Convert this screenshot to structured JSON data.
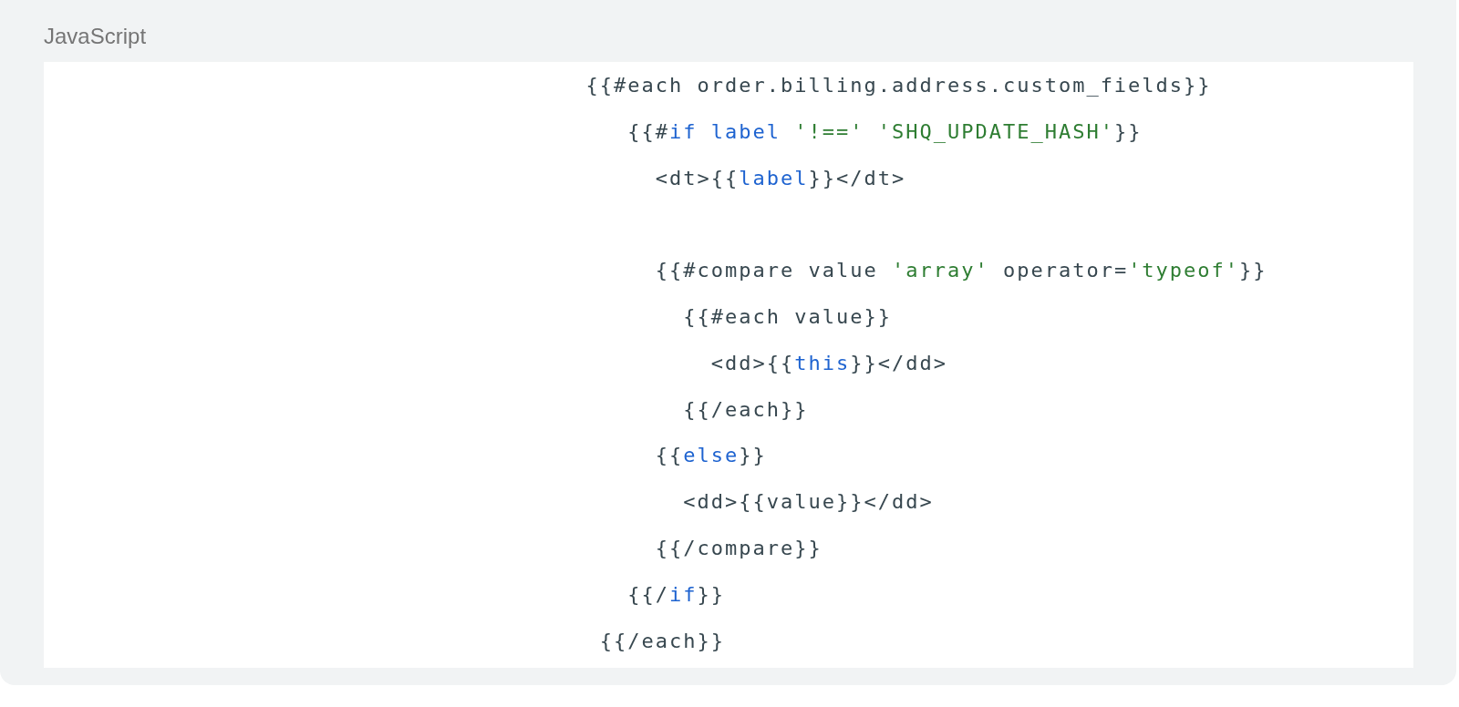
{
  "code_block": {
    "language": "JavaScript",
    "lines": [
      {
        "segments": [
          {
            "text": "                                       {{#each order.billing.address.custom_fields}}",
            "kind": "plain"
          }
        ]
      },
      {
        "segments": [
          {
            "text": "                                          {{#",
            "kind": "plain"
          },
          {
            "text": "if",
            "kind": "keyword"
          },
          {
            "text": " label",
            "kind": "keyword"
          },
          {
            "text": " '!=='",
            "kind": "string"
          },
          {
            "text": " 'SHQ_UPDATE_HASH'",
            "kind": "string"
          },
          {
            "text": "}}",
            "kind": "plain"
          }
        ]
      },
      {
        "segments": [
          {
            "text": "                                            <dt>{{",
            "kind": "plain"
          },
          {
            "text": "label",
            "kind": "keyword"
          },
          {
            "text": "}}</dt>",
            "kind": "plain"
          }
        ]
      },
      {
        "kind": "blank"
      },
      {
        "segments": [
          {
            "text": "                                            {{#compare value ",
            "kind": "plain"
          },
          {
            "text": "'array'",
            "kind": "string"
          },
          {
            "text": " operator=",
            "kind": "plain"
          },
          {
            "text": "'typeof'",
            "kind": "string"
          },
          {
            "text": "}}",
            "kind": "plain"
          }
        ]
      },
      {
        "segments": [
          {
            "text": "                                              {{#each value}}",
            "kind": "plain"
          }
        ]
      },
      {
        "segments": [
          {
            "text": "                                                <dd>{{",
            "kind": "plain"
          },
          {
            "text": "this",
            "kind": "keyword"
          },
          {
            "text": "}}</dd>",
            "kind": "plain"
          }
        ]
      },
      {
        "segments": [
          {
            "text": "                                              {{/each}}",
            "kind": "plain"
          }
        ]
      },
      {
        "segments": [
          {
            "text": "                                            {{",
            "kind": "plain"
          },
          {
            "text": "else",
            "kind": "keyword"
          },
          {
            "text": "}}",
            "kind": "plain"
          }
        ]
      },
      {
        "segments": [
          {
            "text": "                                              <dd>{{value}}</dd>",
            "kind": "plain"
          }
        ]
      },
      {
        "segments": [
          {
            "text": "                                            {{/compare}}",
            "kind": "plain"
          }
        ]
      },
      {
        "segments": [
          {
            "text": "                                          {{/",
            "kind": "plain"
          },
          {
            "text": "if",
            "kind": "keyword"
          },
          {
            "text": "}}",
            "kind": "plain"
          }
        ]
      },
      {
        "segments": [
          {
            "text": "                                        {{/each}}",
            "kind": "plain"
          }
        ]
      }
    ]
  }
}
